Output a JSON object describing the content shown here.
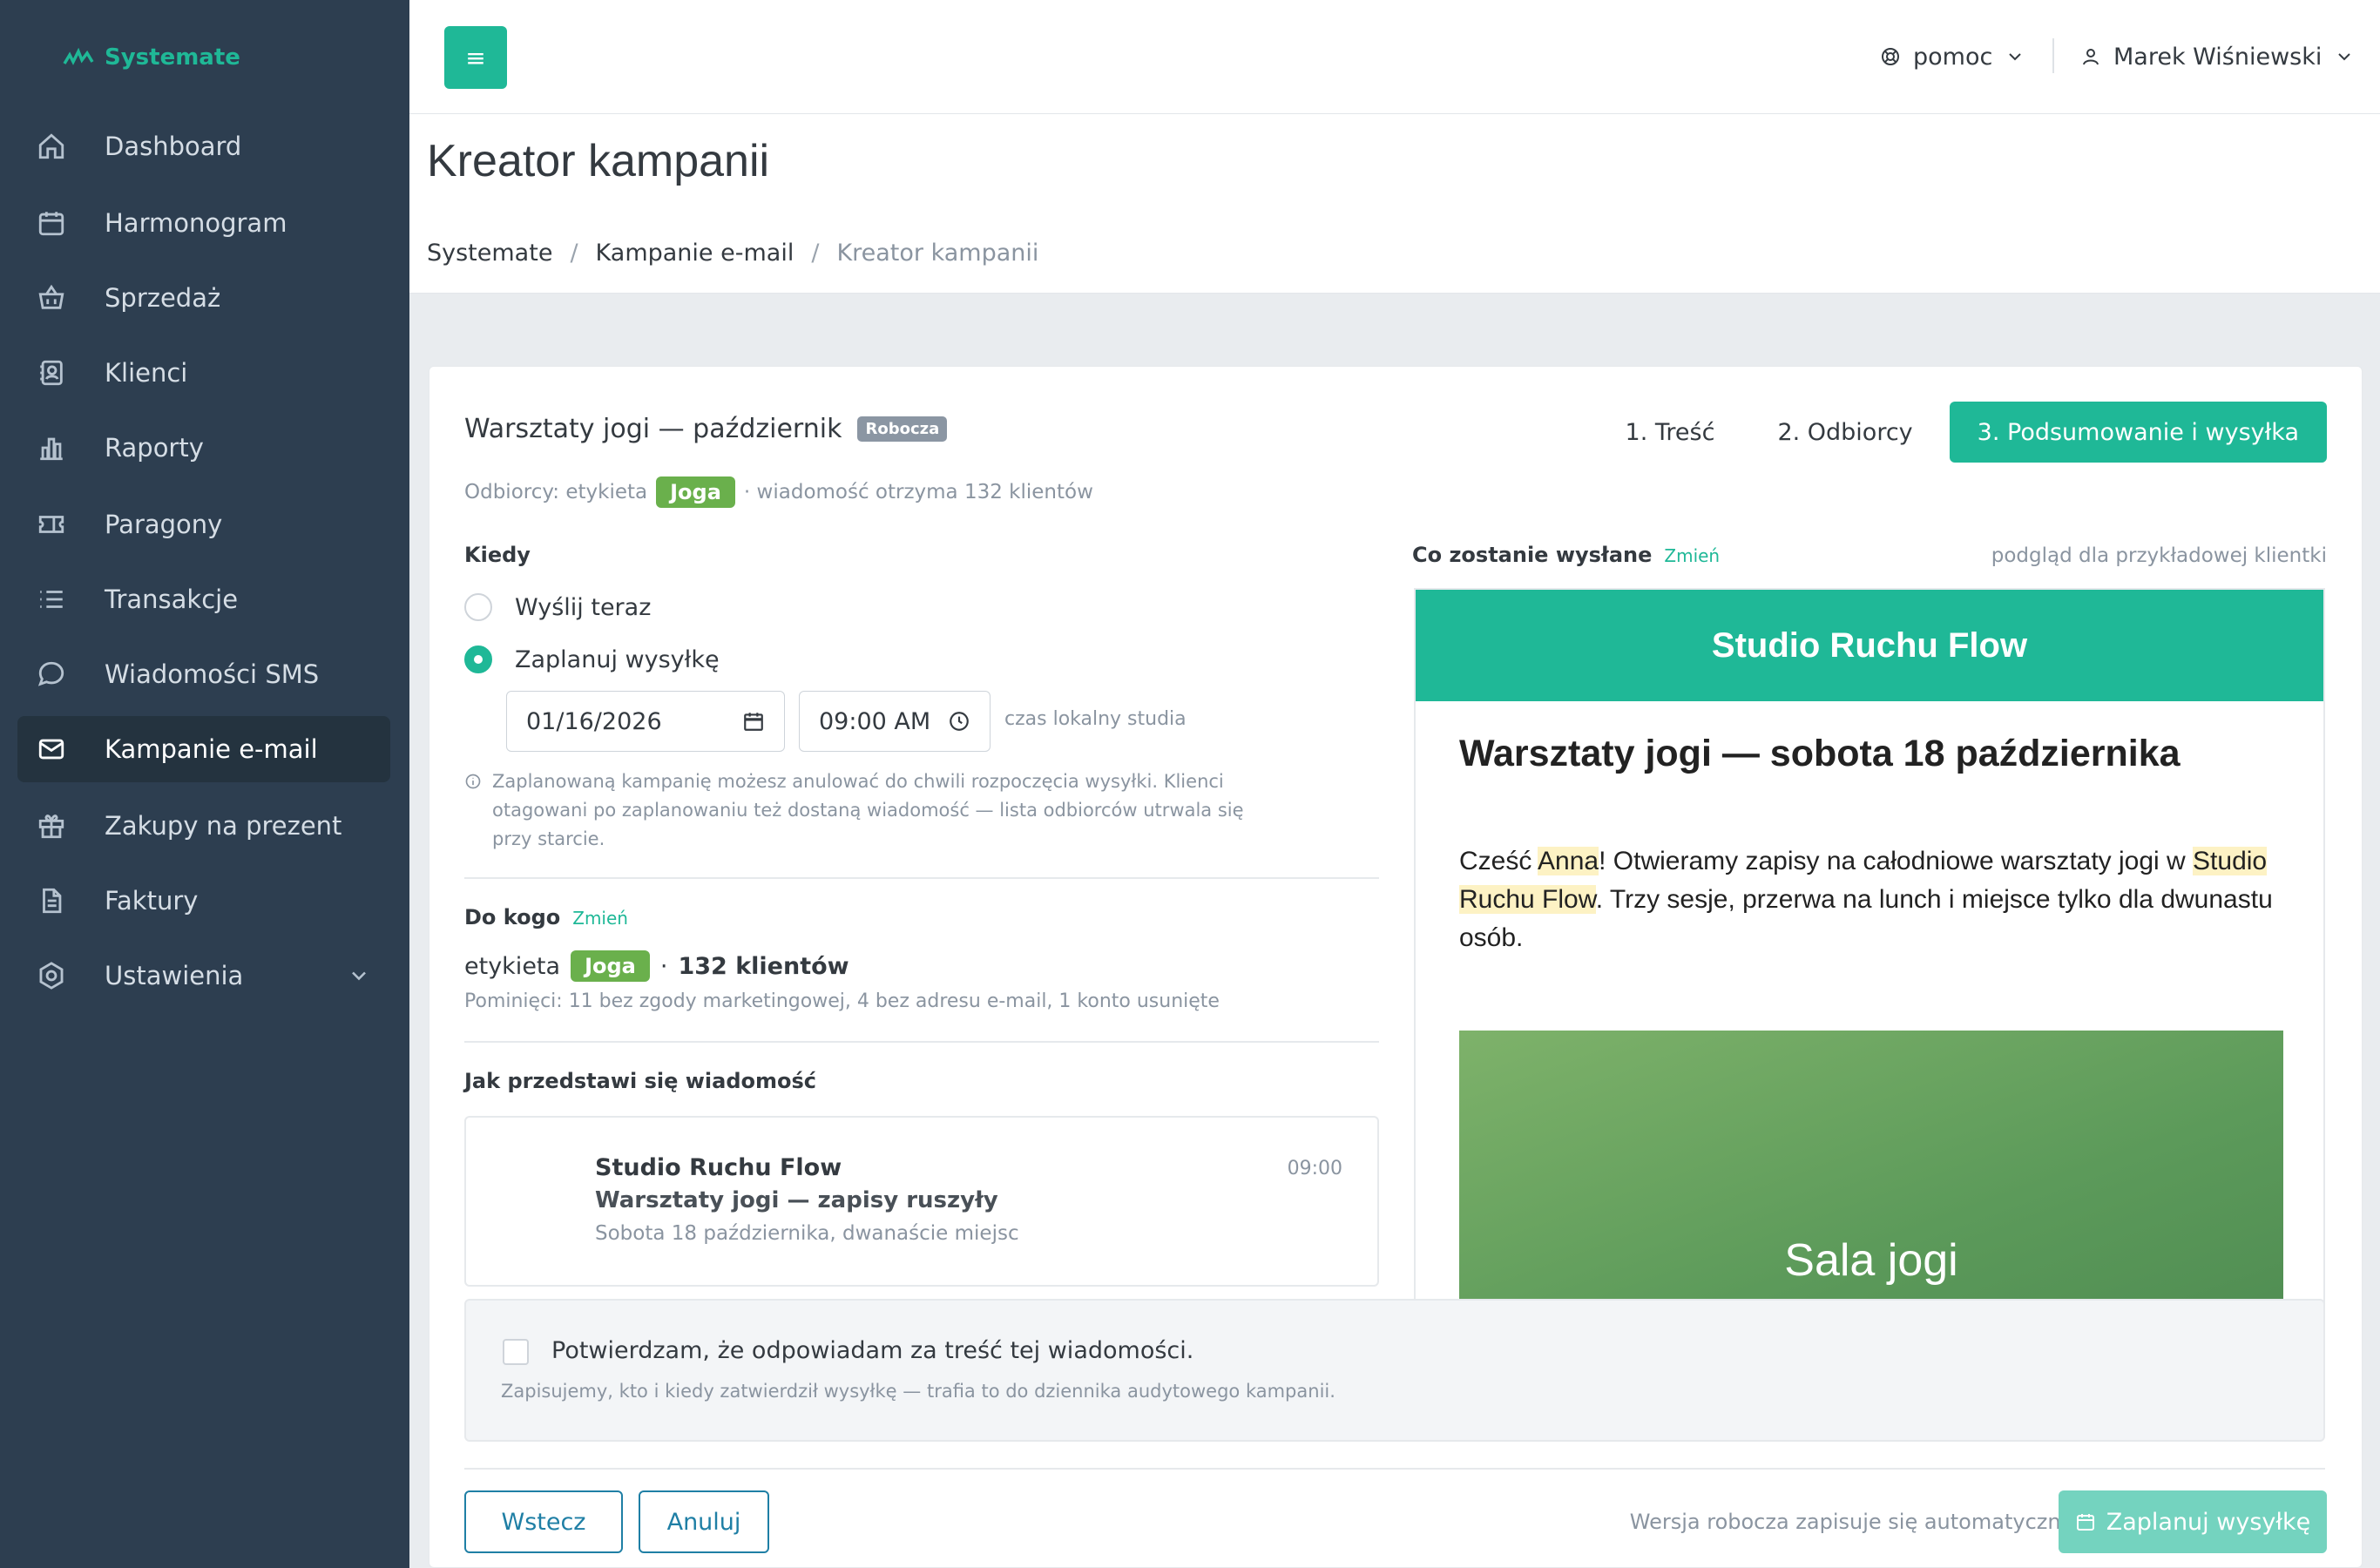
{
  "app": {
    "name": "Systemate"
  },
  "sidebar": {
    "items": [
      {
        "label": "Dashboard",
        "icon": "home-icon"
      },
      {
        "label": "Harmonogram",
        "icon": "calendar-icon"
      },
      {
        "label": "Sprzedaż",
        "icon": "basket-icon"
      },
      {
        "label": "Klienci",
        "icon": "contacts-icon"
      },
      {
        "label": "Raporty",
        "icon": "bar-chart-icon"
      },
      {
        "label": "Paragony",
        "icon": "ticket-icon"
      },
      {
        "label": "Transakcje",
        "icon": "list-icon"
      },
      {
        "label": "Wiadomości SMS",
        "icon": "chat-icon"
      },
      {
        "label": "Kampanie e-mail",
        "icon": "mail-icon",
        "active": true
      },
      {
        "label": "Zakupy na prezent",
        "icon": "gift-icon"
      },
      {
        "label": "Faktury",
        "icon": "document-icon"
      },
      {
        "label": "Ustawienia",
        "icon": "gear-icon"
      }
    ]
  },
  "topbar": {
    "menu_glyph": "≡",
    "help_label": "pomoc",
    "user_name": "Marek Wiśniewski"
  },
  "header": {
    "title": "Kreator kampanii",
    "breadcrumb": [
      "Systemate",
      "Kampanie e-mail",
      "Kreator kampanii"
    ],
    "breadcrumb_sep": "/"
  },
  "campaign": {
    "name": "Warsztaty jogi — październik",
    "status_badge": "Robocza",
    "steps": [
      "1. Treść",
      "2. Odbiorcy",
      "3. Podsumowanie i wysyłka"
    ],
    "recipients_prefix": "Odbiorcy: etykieta",
    "recipients_tag": "Joga",
    "recipients_suffix": "· wiadomość otrzyma 132 klientów"
  },
  "when": {
    "label": "Kiedy",
    "option_now": "Wyślij teraz",
    "option_schedule": "Zaplanuj wysyłkę",
    "date_value": "01/16/2026",
    "time_value": "09:00 AM",
    "timezone_hint": "czas lokalny studia",
    "note": "Zaplanowaną kampanię możesz anulować do chwili rozpoczęcia wysyłki. Klienci otagowani po zaplanowaniu też dostaną wiadomość — lista odbiorców utrwala się przy starcie."
  },
  "to_whom": {
    "label": "Do kogo",
    "change": "Zmień",
    "prefix": "etykieta",
    "tag": "Joga",
    "dot": "·",
    "count": "132 klientów",
    "skipped": "Pominięci: 11 bez zgody marketingowej, 4 bez adresu e-mail, 1 konto usunięte"
  },
  "inbox_preview": {
    "label": "Jak przedstawi się wiadomość",
    "sender": "Studio Ruchu Flow",
    "subject": "Warsztaty jogi — zapisy ruszyły",
    "preheader": "Sobota 18 października, dwanaście miejsc",
    "time": "09:00"
  },
  "email_preview": {
    "label": "Co zostanie wysłane",
    "change": "Zmień",
    "hint": "podgląd dla przykładowej klientki",
    "brand": "Studio Ruchu Flow",
    "headline": "Warsztaty jogi — sobota 18 października",
    "body_1": "Cześć ",
    "body_name": "Anna",
    "body_2": "! Otwieramy zapisy na całodniowe warsztaty jogi w ",
    "body_studio": "Studio Ruchu Flow",
    "body_3": ". Trzy sesje, przerwa na lunch i miejsce tylko dla dwunastu osób.",
    "image_caption": "Sala jogi"
  },
  "confirm": {
    "label": "Potwierdzam, że odpowiadam za treść tej wiadomości.",
    "sub": "Zapisujemy, kto i kiedy zatwierdził wysyłkę — trafia to do dziennika audytowego kampanii."
  },
  "footer": {
    "back": "Wstecz",
    "cancel": "Anuluj",
    "autosave": "Wersja robocza zapisuje się automatycznie",
    "schedule": "Zaplanuj wysyłkę"
  },
  "colors": {
    "accent": "#1fb897",
    "sidebar": "#2d3e50",
    "tag": "#6ab04c",
    "outline": "#1f7fa5"
  }
}
